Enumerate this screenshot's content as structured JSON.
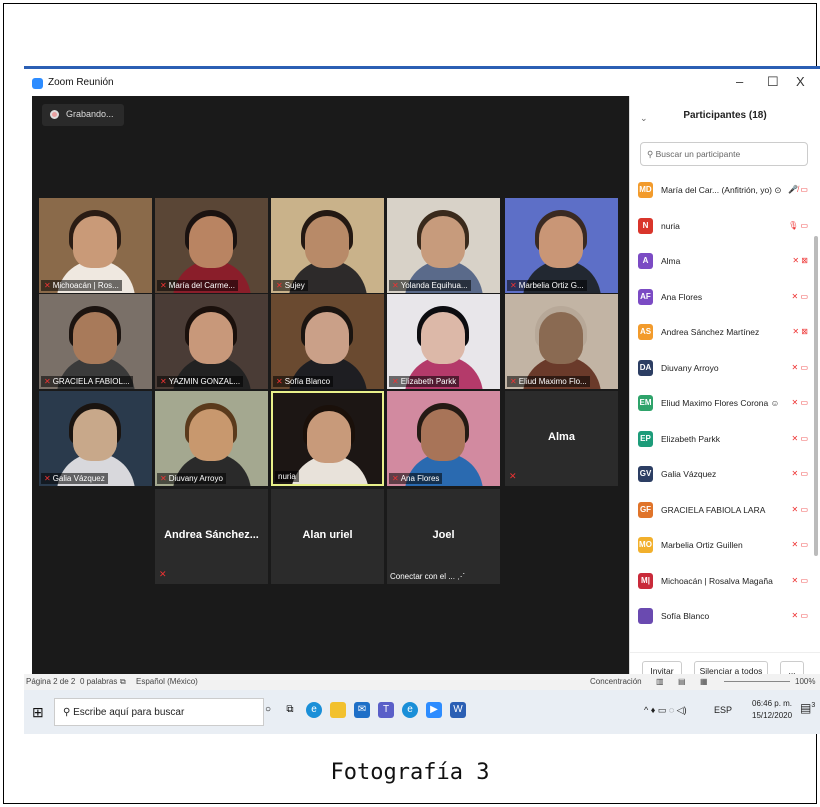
{
  "window": {
    "title": "Zoom Reunión",
    "controls": [
      "–",
      "☐",
      "X"
    ]
  },
  "recording": {
    "label": "Grabando..."
  },
  "tiles": [
    {
      "name": "Michoacán | Ros...",
      "muted": true,
      "type": "video",
      "bg": "#8a6a4a",
      "skin": "#c99a78",
      "hair": "#2a1c14",
      "shirt": "#efe8e0"
    },
    {
      "name": "María del Carme...",
      "muted": true,
      "type": "video",
      "bg": "#5a4636",
      "skin": "#b98462",
      "hair": "#1a1210",
      "shirt": "#8a1e2a"
    },
    {
      "name": "Sujey",
      "muted": true,
      "type": "video",
      "bg": "#c9b28a",
      "skin": "#b88a68",
      "hair": "#231812",
      "shirt": "#2d2a2a"
    },
    {
      "name": "Yolanda Equihua...",
      "muted": true,
      "type": "video",
      "bg": "#d8d2c8",
      "skin": "#c79b7c",
      "hair": "#3a2a1c",
      "shirt": "#5a6a8a"
    },
    {
      "name": "Marbelia Ortiz G...",
      "muted": true,
      "type": "video",
      "bg": "#5d6fc7",
      "skin": "#c99676",
      "hair": "#3a2a22",
      "shirt": "#222831"
    },
    {
      "name": "GRACIELA FABIOL...",
      "muted": true,
      "type": "video",
      "bg": "#7a7068",
      "skin": "#a87a5a",
      "hair": "#1c1410",
      "shirt": "#3a3a3a"
    },
    {
      "name": "YAZMIN GONZAL...",
      "muted": true,
      "type": "video",
      "bg": "#4a3c36",
      "skin": "#c8987a",
      "hair": "#1a100c",
      "shirt": "#222"
    },
    {
      "name": "Sofía Blanco",
      "muted": true,
      "type": "video",
      "bg": "#6a4a30",
      "skin": "#caa088",
      "hair": "#1a1410",
      "shirt": "#1e1e22"
    },
    {
      "name": "Elizabeth Parkk",
      "muted": true,
      "type": "video",
      "bg": "#e8e6ea",
      "skin": "#dcb8a8",
      "hair": "#0c0c10",
      "shirt": "#b43a6a"
    },
    {
      "name": "Eliud Maximo Flo...",
      "muted": true,
      "type": "video",
      "bg": "#c2b4a4",
      "skin": "#8a6a52",
      "hair": "#b7a898",
      "shirt": "#6a3a2a"
    },
    {
      "name": "Galia Vázquez",
      "muted": true,
      "type": "video",
      "bg": "#2a3a4c",
      "skin": "#c8a88a",
      "hair": "#1a1410",
      "shirt": "#d8d8dc"
    },
    {
      "name": "Diuvany Arroyo",
      "muted": true,
      "type": "video",
      "bg": "#a4a890",
      "skin": "#c8986e",
      "hair": "#5a3a1c",
      "shirt": "#2a2a2a"
    },
    {
      "name": "nuria",
      "muted": false,
      "type": "video",
      "active": true,
      "bg": "#1c1614",
      "skin": "#c89a7a",
      "hair": "#1a100a",
      "shirt": "#e8e2da"
    },
    {
      "name": "Ana Flores",
      "muted": true,
      "type": "video",
      "bg": "#d28aa0",
      "skin": "#a87458",
      "hair": "#241a14",
      "shirt": "#2a6ab0"
    },
    {
      "name": "Alma",
      "muted": true,
      "type": "name"
    },
    {
      "name": "Andrea Sánchez...",
      "muted": true,
      "type": "name"
    },
    {
      "name": "Alan uriel",
      "muted": false,
      "type": "name"
    },
    {
      "name": "Joel",
      "muted": false,
      "type": "name",
      "sub": "Conectar con el ... ⋰"
    }
  ],
  "participants_panel": {
    "title": "Participantes (18)",
    "search_placeholder": "Buscar un participante",
    "items": [
      {
        "initials": "MD",
        "name": "María del Car... (Anfitrión, yo) ⊙",
        "color": "#f29b2c",
        "icons": "🎤̸ ▭"
      },
      {
        "initials": "N",
        "name": "nuria",
        "color": "#d9352b",
        "icons": "🎙 ▭"
      },
      {
        "initials": "A",
        "name": "Alma",
        "color": "#7b4bc4",
        "icons": "✕ ⊠"
      },
      {
        "initials": "AF",
        "name": "Ana Flores",
        "color": "#7b4bc4",
        "icons": "✕ ▭"
      },
      {
        "initials": "AS",
        "name": "Andrea Sánchez Martínez",
        "color": "#f29b2c",
        "icons": "✕ ⊠"
      },
      {
        "initials": "DA",
        "name": "Diuvany Arroyo",
        "color": "#2c3e63",
        "icons": "✕ ▭"
      },
      {
        "initials": "EM",
        "name": "Eliud Maximo Flores Corona ☺",
        "color": "#2ea36a",
        "icons": "✕ ▭"
      },
      {
        "initials": "EP",
        "name": "Elizabeth Parkk",
        "color": "#1d9c7a",
        "icons": "✕ ▭"
      },
      {
        "initials": "GV",
        "name": "Galia Vázquez",
        "color": "#2c3e63",
        "icons": "✕ ▭"
      },
      {
        "initials": "GF",
        "name": "GRACIELA FABIOLA LARA",
        "color": "#e0742a",
        "icons": "✕ ▭"
      },
      {
        "initials": "MO",
        "name": "Marbelia Ortiz Guillen",
        "color": "#f2b02c",
        "icons": "✕ ▭"
      },
      {
        "initials": "M|",
        "name": "Michoacán | Rosalva Magaña",
        "color": "#c92a3a",
        "icons": "✕ ▭"
      },
      {
        "initials": "",
        "name": "Sofía Blanco",
        "color": "#6a4ab0",
        "icons": "✕ ▭"
      }
    ],
    "invite_label": "Invitar",
    "mute_all_label": "Silenciar a todos",
    "more_label": "..."
  },
  "statusbar": {
    "page": "Página 2 de 2",
    "words": "0 palabras",
    "lang": "Español (México)",
    "focus": "Concentración",
    "zoom": "100%"
  },
  "taskbar": {
    "search_placeholder": "Escribe aquí para buscar",
    "lang": "ESP",
    "time": "06:46 p. m.",
    "date": "15/12/2020",
    "notif_count": "3"
  },
  "caption": "Fotografía 3"
}
